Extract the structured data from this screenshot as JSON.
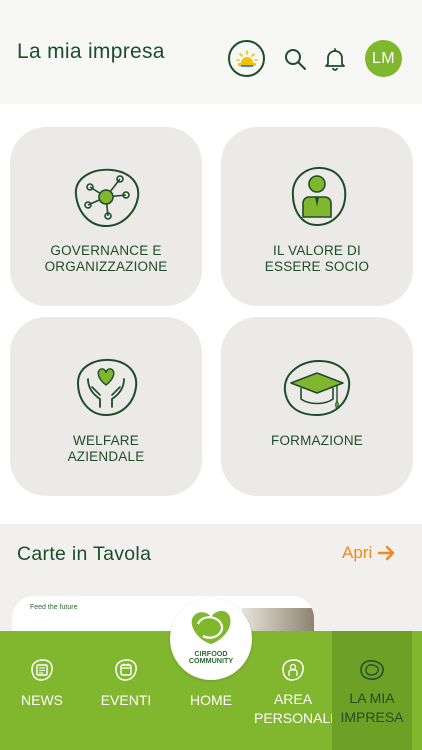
{
  "header": {
    "title": "La mia impresa",
    "avatar_initials": "LM",
    "icons": [
      "weather-sun-icon",
      "search-icon",
      "bell-icon"
    ]
  },
  "tiles": [
    {
      "label_lines": [
        "GOVERNANCE E",
        "ORGANIZZAZIONE"
      ],
      "icon": "network-icon"
    },
    {
      "label_lines": [
        "IL VALORE DI",
        "ESSERE SOCIO"
      ],
      "icon": "person-icon"
    },
    {
      "label_lines": [
        "WELFARE",
        "AZIENDALE"
      ],
      "icon": "heart-hands-icon"
    },
    {
      "label_lines": [
        "FORMAZIONE"
      ],
      "icon": "graduation-cap-icon"
    }
  ],
  "section": {
    "title": "Carte in Tavola",
    "action_label": "Apri",
    "card_tagline": "Feed the future"
  },
  "fab": {
    "logo_lines": [
      "CIRFOOD",
      "COMMUNITY"
    ]
  },
  "nav": {
    "items": [
      {
        "label": "NEWS",
        "icon": "newspaper-icon"
      },
      {
        "label": "EVENTI",
        "icon": "calendar-icon"
      },
      {
        "label": "HOME",
        "icon": "cirfood-logo-icon"
      },
      {
        "label_lines": [
          "AREA",
          "PERSONALE"
        ],
        "icon": "user-badge-icon"
      },
      {
        "label_lines": [
          "LA MIA",
          "IMPRESA"
        ],
        "icon": "company-icon",
        "active": true
      }
    ]
  },
  "colors": {
    "primary_dark": "#1e4d2b",
    "primary_green": "#80b72f",
    "accent_orange": "#f08a1c",
    "tile_bg": "#eceae7"
  }
}
